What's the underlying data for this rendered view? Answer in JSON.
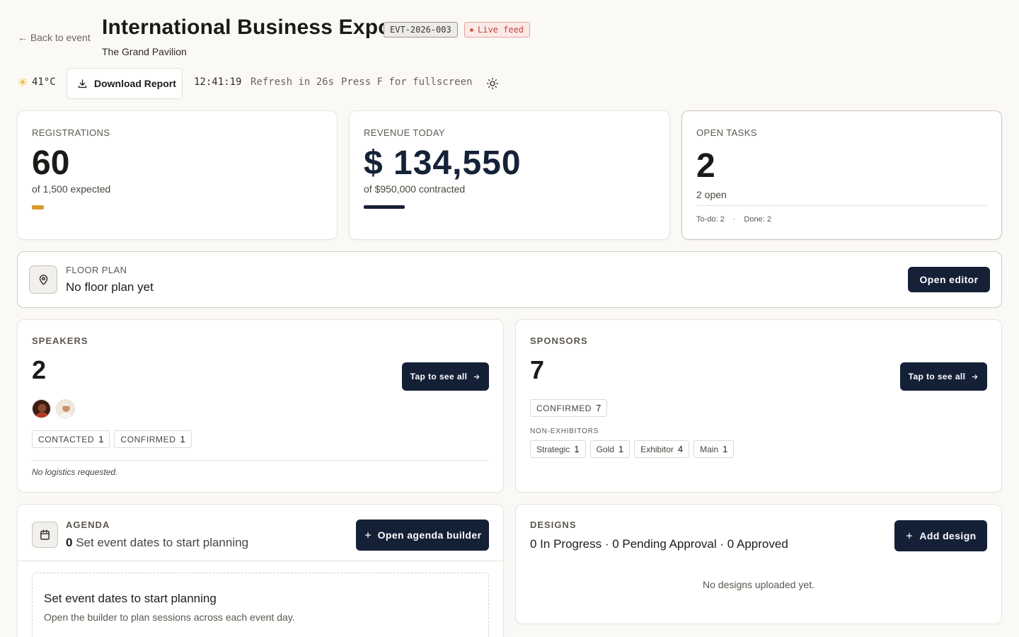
{
  "header": {
    "back_label": "← Back to event",
    "title": "International Business Expo",
    "event_id": "EVT-2026-003",
    "live_label": "Live feed",
    "venue": "The Grand Pavilion"
  },
  "toolbar": {
    "temperature": "41°C",
    "download_label": "Download Report",
    "clock": "12:41:19",
    "refresh": "Refresh in 26s",
    "fullscreen_hint": "Press F for fullscreen"
  },
  "registrations": {
    "label": "REGISTRATIONS",
    "value": "60",
    "sub": "of 1,500 expected",
    "progress": 0.04,
    "color": "#d99a2b"
  },
  "revenue": {
    "label": "REVENUE TODAY",
    "value": "$ 134,550",
    "sub": "of $950,000 contracted",
    "progress": 0.14,
    "color": "#152238"
  },
  "tasks": {
    "label": "OPEN TASKS",
    "value": "2",
    "sub": "2 open",
    "todo": "To-do: 2",
    "separator": "·",
    "done": "Done: 2"
  },
  "floor_plan": {
    "label": "FLOOR PLAN",
    "status": "No floor plan yet",
    "button": "Open editor"
  },
  "speakers": {
    "label": "SPEAKERS",
    "value": "2",
    "button": "Tap to see all",
    "statuses": [
      {
        "label": "CONTACTED",
        "count": "1"
      },
      {
        "label": "CONFIRMED",
        "count": "1"
      }
    ],
    "note": "No logistics requested."
  },
  "sponsors": {
    "label": "SPONSORS",
    "value": "7",
    "button": "Tap to see all",
    "confirmed": {
      "label": "CONFIRMED",
      "count": "7"
    },
    "non_exhibitors_label": "NON-EXHIBITORS",
    "tiers": [
      {
        "label": "Strategic",
        "count": "1"
      },
      {
        "label": "Gold",
        "count": "1"
      },
      {
        "label": "Exhibitor",
        "count": "4"
      },
      {
        "label": "Main",
        "count": "1"
      }
    ]
  },
  "agenda": {
    "label": "AGENDA",
    "count": "0",
    "status": "Set event dates to start planning",
    "button": "Open agenda builder",
    "empty_title": "Set event dates to start planning",
    "empty_text": "Open the builder to plan sessions across each event day."
  },
  "designs": {
    "label": "DESIGNS",
    "status": "0 In Progress · 0 Pending Approval · 0 Approved",
    "button": "Add design",
    "empty": "No designs uploaded yet."
  }
}
